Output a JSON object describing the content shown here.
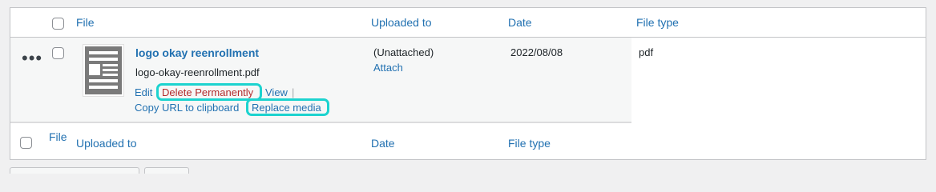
{
  "table": {
    "header": {
      "file": "File",
      "uploaded_to": "Uploaded to",
      "date": "Date",
      "file_type": "File type"
    },
    "row": {
      "title": "logo okay reenrollment",
      "filename": "logo-okay-reenrollment.pdf",
      "uploaded_to": "(Unattached)",
      "attach_label": "Attach",
      "date": "2022/08/08",
      "file_type": "pdf",
      "actions": {
        "edit": "Edit",
        "delete": "Delete Permanently",
        "view": "View",
        "separator": "|",
        "copy_url": "Copy URL to clipboard",
        "replace": "Replace media"
      }
    },
    "footer": {
      "file": "File",
      "uploaded_to": "Uploaded to",
      "date": "Date",
      "file_type": "File type"
    }
  },
  "colors": {
    "link": "#2271b1",
    "delete": "#b32d2e",
    "highlight": "#1cd3cf"
  },
  "icons": {
    "row_actions": "ellipsis-icon",
    "thumbnail": "document-icon"
  }
}
